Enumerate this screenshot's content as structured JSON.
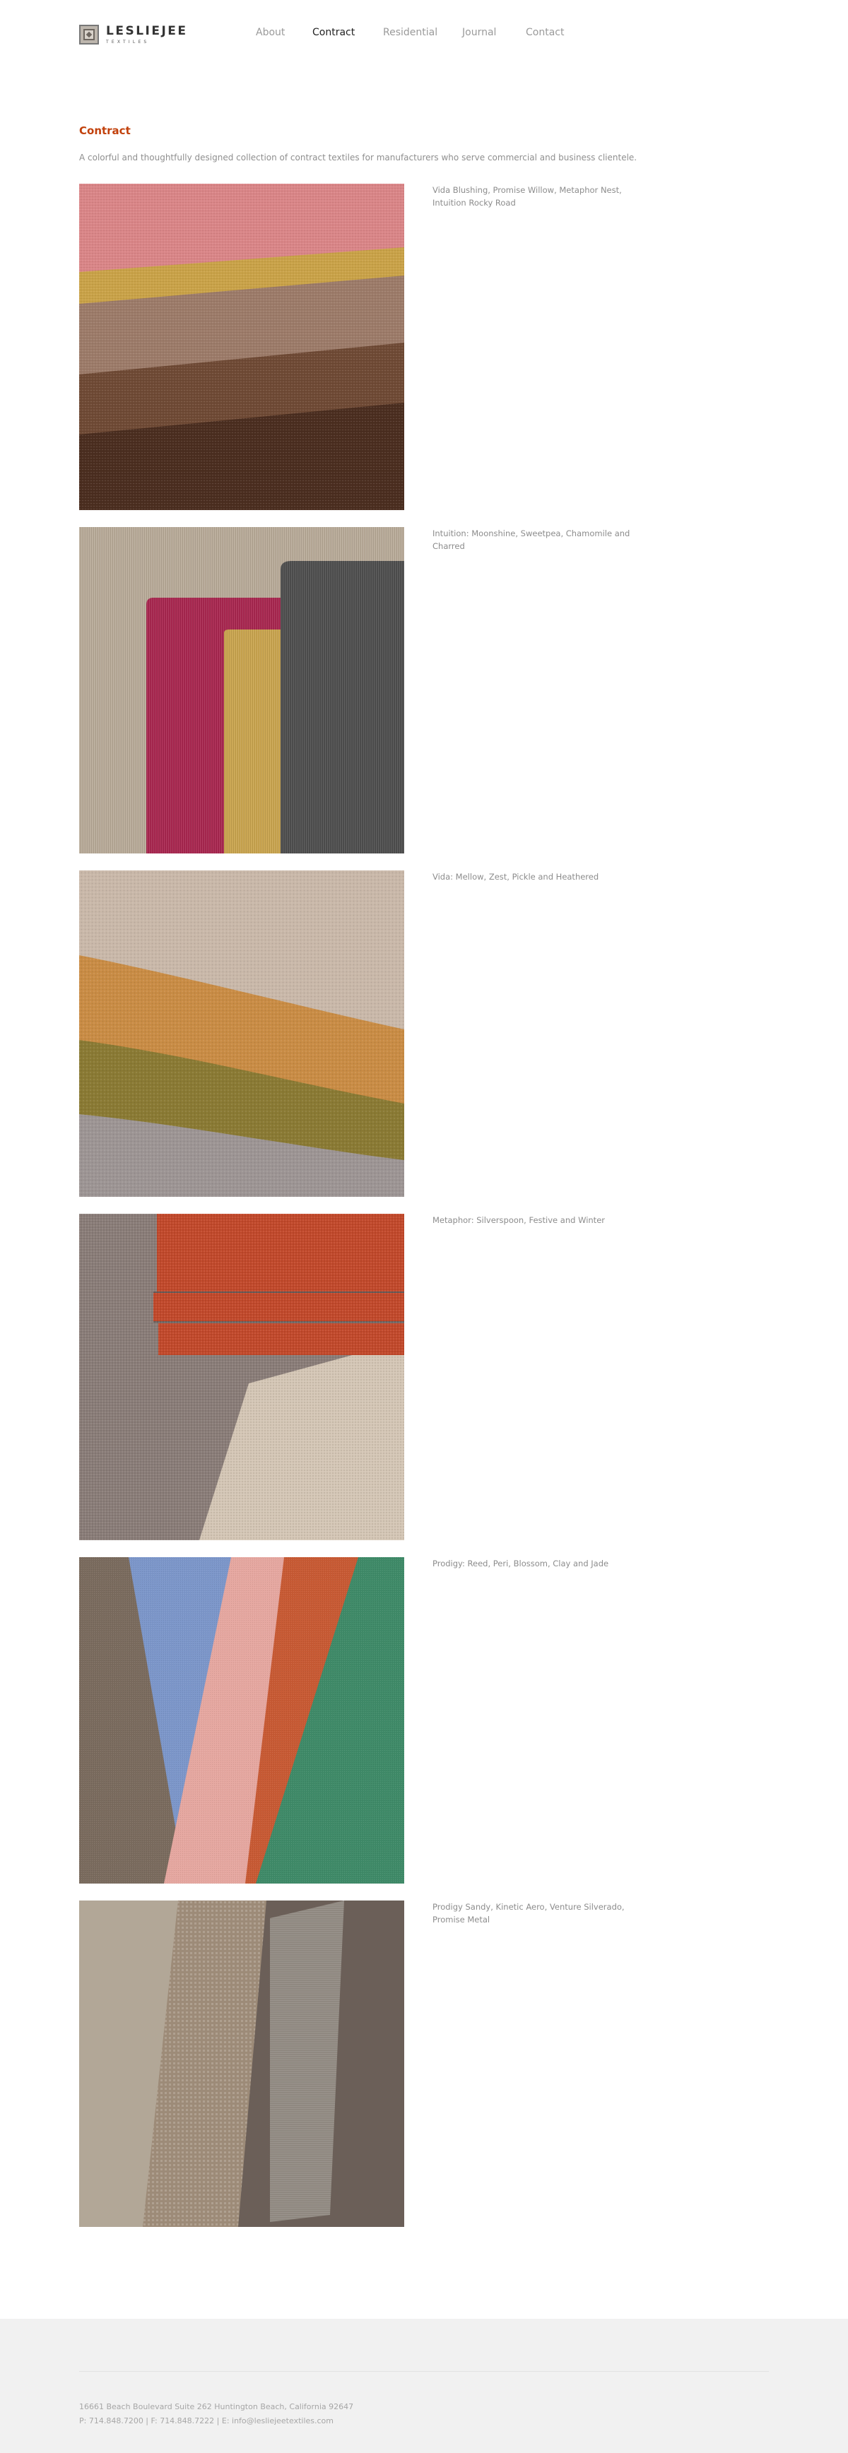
{
  "brand": {
    "name": "LESLIEJEE",
    "subtitle": "TEXTILES"
  },
  "nav": {
    "items": [
      {
        "label": "About"
      },
      {
        "label": "Contract"
      },
      {
        "label": "Residential"
      },
      {
        "label": "Journal"
      },
      {
        "label": "Contact"
      }
    ],
    "active": "Contract"
  },
  "page": {
    "title": "Contract",
    "intro": "A colorful and thoughtfully designed collection of contract textiles for manufacturers who serve commercial and business clientele.",
    "accent_color": "#c2410c"
  },
  "gallery": [
    {
      "caption": "Vida Blushing, Promise Willow, Metaphor Nest, Intuition Rocky Road",
      "colors": [
        "#d98587",
        "#c9a248",
        "#9c7b69",
        "#6f4a35",
        "#4b2e20"
      ]
    },
    {
      "caption": "Intuition: Moonshine, Sweetpea, Chamomile and Charred",
      "colors": [
        "#b8aa98",
        "#a8264f",
        "#c9a44e",
        "#4e4e4e"
      ]
    },
    {
      "caption": "Vida: Mellow, Zest, Pickle and Heathered",
      "colors": [
        "#c9b8a9",
        "#c98c45",
        "#8a7a34",
        "#9d9594"
      ]
    },
    {
      "caption": "Metaphor: Silverspoon, Festive and Winter",
      "colors": [
        "#8a7d78",
        "#c2492b",
        "#d4c6b5"
      ]
    },
    {
      "caption": "Prodigy: Reed, Peri, Blossom, Clay and Jade",
      "colors": [
        "#7a6b5e",
        "#7c96c9",
        "#e5a7a0",
        "#c75a34",
        "#3f8a68"
      ]
    },
    {
      "caption_lines": [
        "Prodigy Sandy, Kinetic Aero, Venture Silverado,",
        "Promise Metal"
      ],
      "colors": [
        "#b2a797",
        "#9d8b78",
        "#8f8880",
        "#6b5f58"
      ]
    }
  ],
  "footer": {
    "address": "16661 Beach Boulevard Suite 262 Huntington Beach, California 92647",
    "contact": "P: 714.848.7200 | F: 714.848.7222 | E: info@lesliejeetextiles.com"
  }
}
